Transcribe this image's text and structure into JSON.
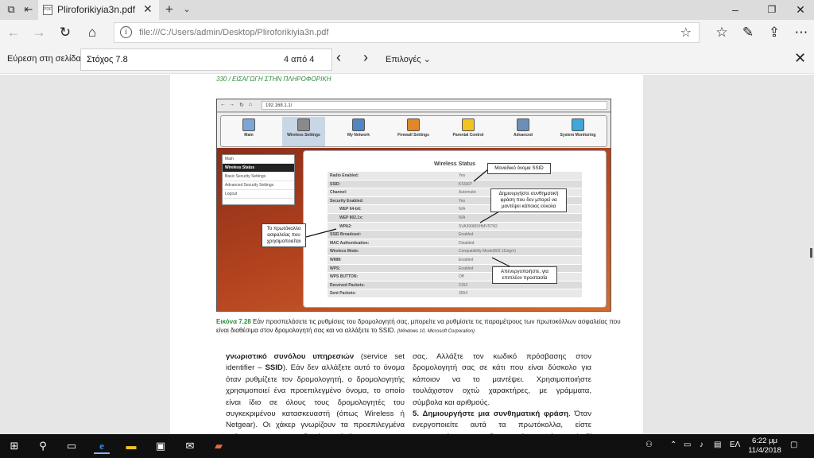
{
  "browser": {
    "tab_title": "Pliroforikiyia3n.pdf",
    "favicon_text": "PDF",
    "address": "file:///C:/Users/admin/Desktop/Pliroforikiyia3n.pdf"
  },
  "findbar": {
    "label": "Εύρεση στη σελίδα",
    "query": "Στόχος 7.8",
    "count": "4 από 4",
    "options": "Επιλογές"
  },
  "pdf": {
    "running_head": "330  /  ΕΙΣΑΓΩΓΗ ΣΤΗΝ ΠΛΗΡΟΦΟΡΙΚΗ",
    "figure": {
      "url": "192.168.1.1/",
      "menu": [
        "Main",
        "Wireless Settings",
        "My Network",
        "Firewall Settings",
        "Parental Control",
        "Advanced",
        "System Monitoring"
      ],
      "menu_colors": [
        "#7aa7d6",
        "#8a8a8a",
        "#4f86c6",
        "#e0862b",
        "#f2c321",
        "#6b8fb8",
        "#3fa7d9"
      ],
      "side": [
        "Main",
        "Wireless Status",
        "Basic Security Settings",
        "Advanced Security Settings",
        "Logout"
      ],
      "panel_title": "Wireless Status",
      "rows": [
        {
          "k": "Radio Enabled:",
          "v": "Yes"
        },
        {
          "k": "SSID:",
          "v": "KSSKP"
        },
        {
          "k": "Channel:",
          "v": "Automatic"
        },
        {
          "k": "Security Enabled:",
          "v": "Yes"
        },
        {
          "k": "WEP 64-bit:",
          "v": "N/A"
        },
        {
          "k": "WEP 802.1x:",
          "v": "N/A"
        },
        {
          "k": "WPA2:",
          "v": "SVA3998ISHMV5TN2"
        },
        {
          "k": "SSID Broadcast:",
          "v": "Enabled"
        },
        {
          "k": "MAC Authentication:",
          "v": "Disabled"
        },
        {
          "k": "Wireless Mode:",
          "v": "Compatibility Mode(802.11b/g/n)"
        },
        {
          "k": "WMM:",
          "v": "Enabled"
        },
        {
          "k": "WPS:",
          "v": "Enabled"
        },
        {
          "k": "WPS BUTTON:",
          "v": "Off"
        },
        {
          "k": "Received Packets:",
          "v": "2153"
        },
        {
          "k": "Sent Packets:",
          "v": "3554"
        }
      ],
      "callouts": {
        "ssid": "Μοναδικό όνομα SSID",
        "passphrase": "Δημιουργήστε συνθηματική φράση που δεν μπορεί να μαντέψει κάποιος εύκολα",
        "protocol": "Το πρωτόκολλο ασφαλείας που χρησιμοποιείται",
        "disable": "Απενεργοποιήστε, για επιπλέον προστασία"
      }
    },
    "caption": {
      "label": "Εικόνα 7.28",
      "text": "Εάν προσπελάσετε τις ρυθμίσεις του δρομολογητή σας, μπορείτε να ρυθμίσετε τις παραμέτρους των πρωτοκόλλων ασφαλείας που είναι διαθέσιμα στον δρομολογητή σας και να αλλάξετε το SSID.",
      "source": "(Windows 10, Microsoft Corporation)"
    },
    "left_col": {
      "bold1": "γνωριστικό συνόλου υπηρεσιών",
      "t1": " (service set identifier – ",
      "bold2": "SSID",
      "t2": "). Εάν δεν αλλάξετε αυτό το όνομα όταν ρυθμίζετε τον δρομολογητή, ο δρομολογητής χρησιμοποιεί ένα προεπιλεγμένο όνομα, το οποίο είναι ίδιο σε όλους τους δρομολογητές του συγκεκριμένου κατασκευαστή (όπως Wireless ή Netgear). Οι χάκερ γνωρίζουν τα προεπιλεγμένα ονόματα και τους κωδικούς πρόσβασης για τους δρομολογητές."
    },
    "right_col": {
      "t1": "σας. Αλλάξτε τον κωδικό πρόσβασης στον δρομολογητή σας σε κάτι που είναι δύσκολο για κάποιον να το μαντέψει. Χρησιμοποιήστε τουλάχιστον οχτώ χαρακτήρες, με γράμματα, σύμβολα και αριθμούς.",
      "num": "5.",
      "bold": " Δημιουργήστε μια συνθηματική φράση",
      "t2": ". Όταν ενεργοποιείτε αυτά τα πρωτόκολλα, είστε αναγκασμένοι να δημιουργήσετε ένα κλειδί κρυπτογράφησης ασφαλείας (συνθηματική φράση). Όταν"
    }
  },
  "taskbar": {
    "lang": "ΕΛ",
    "time": "6:22 μμ",
    "date": "11/4/2018"
  }
}
